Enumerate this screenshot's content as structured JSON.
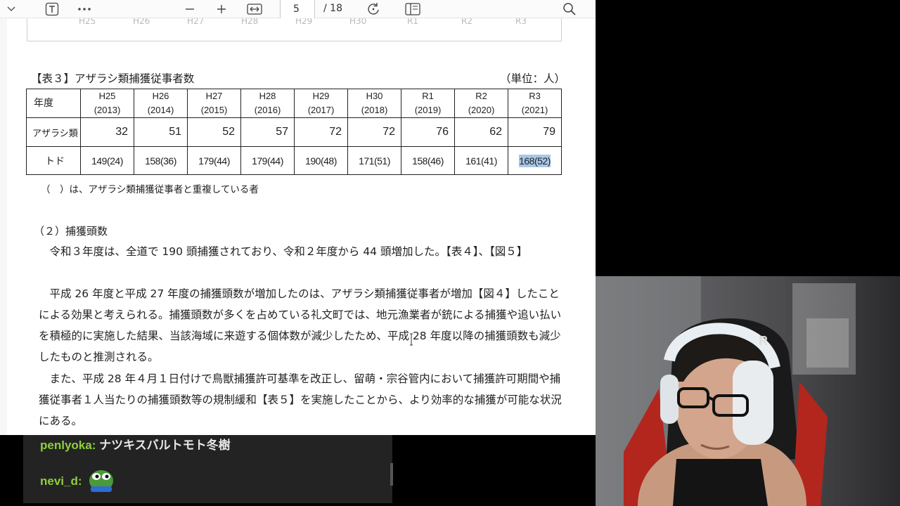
{
  "toolbar": {
    "current_page": "5",
    "total_pages": "/ 18"
  },
  "prev_chart": {
    "year_labels": [
      "H25",
      "H26",
      "H27",
      "H28",
      "H29",
      "H30",
      "R1",
      "R2",
      "R3"
    ]
  },
  "table3": {
    "title": "【表３】アザラシ類捕獲従事者数",
    "unit": "（単位：人）",
    "header_label": "年度",
    "years": [
      {
        "era": "H25",
        "ad": "(2013)"
      },
      {
        "era": "H26",
        "ad": "(2014)"
      },
      {
        "era": "H27",
        "ad": "(2015)"
      },
      {
        "era": "H28",
        "ad": "(2016)"
      },
      {
        "era": "H29",
        "ad": "(2017)"
      },
      {
        "era": "H30",
        "ad": "(2018)"
      },
      {
        "era": "R1",
        "ad": "(2019)"
      },
      {
        "era": "R2",
        "ad": "(2020)"
      },
      {
        "era": "R3",
        "ad": "(2021)"
      }
    ],
    "rows": [
      {
        "label": "アザラシ類",
        "values": [
          "32",
          "51",
          "52",
          "57",
          "72",
          "72",
          "76",
          "62",
          "79"
        ]
      },
      {
        "label": "トド",
        "values": [
          "149(24)",
          "158(36)",
          "179(44)",
          "179(44)",
          "190(48)",
          "171(51)",
          "158(46)",
          "161(41)",
          "168(52)"
        ]
      }
    ],
    "note": "（　）は、アザラシ類捕獲従事者と重複している者"
  },
  "section": {
    "title": "（２）捕獲頭数",
    "para1": "　令和３年度は、全道で 190 頭捕獲されており、令和２年度から 44 頭増加した。【表４】、【図５】",
    "para2": "　平成 26 年度と平成 27 年度の捕獲頭数が増加したのは、アザラシ類捕獲従事者が増加【図４】したことによる効果と考えられる。捕獲頭数が多くを占めている礼文町では、地元漁業者が銃による捕獲や追い払いを積極的に実施した結果、当該海域に来遊する個体数が減少したため、平成 28 年度以降の捕獲頭数も減少したものと推測される。",
    "para3": "　また、平成 28 年４月１日付けで鳥獣捕獲許可基準を改正し、留萌・宗谷管内において捕獲許可期間や捕獲従事者１人当たりの捕獲頭数等の規制緩和【表５】を実施したことから、より効率的な捕獲が可能な状況にある。"
  },
  "chat": [
    {
      "user": "penlyoka:",
      "message": "ナツキスバルトモト冬樹"
    },
    {
      "user": "nevi_d:",
      "message": ""
    }
  ],
  "webcam": {
    "headset_text": "R"
  }
}
